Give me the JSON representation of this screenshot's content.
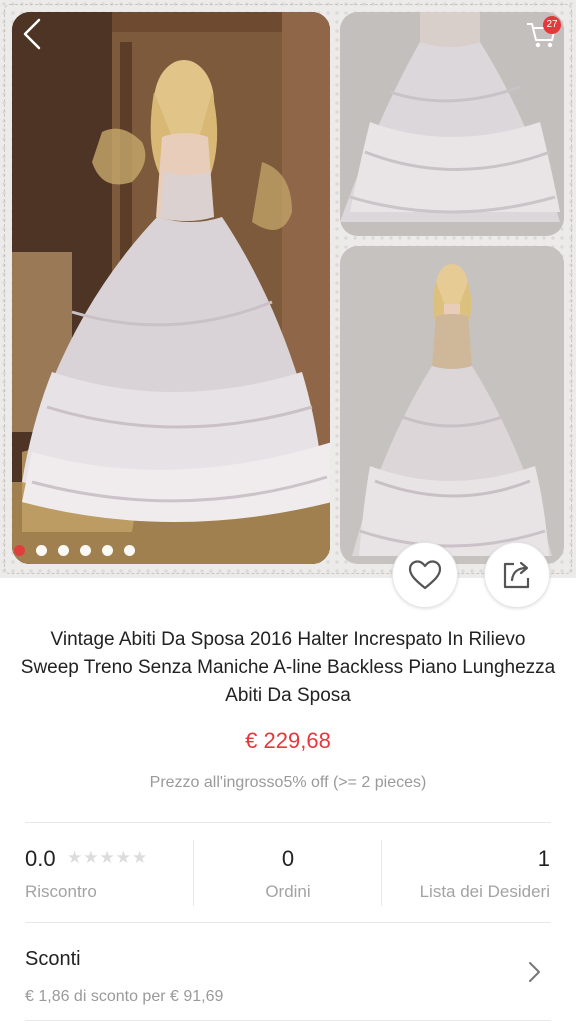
{
  "header": {
    "back_icon": "chevron-left-icon",
    "cart_icon": "shopping-cart-icon",
    "cart_count": "27"
  },
  "gallery": {
    "dots_total": 6,
    "active_dot": 0
  },
  "actions": {
    "favorite_icon": "heart-outline-icon",
    "share_icon": "share-icon"
  },
  "product": {
    "title": "Vintage Abiti Da Sposa 2016 Halter Increspato In Rilievo Sweep Treno Senza Maniche A-line Backless Piano Lunghezza Abiti Da Sposa",
    "price": "€ 229,68",
    "wholesale": "Prezzo all'ingrosso5% off (>= 2 pieces)",
    "price_color": "#e4393c"
  },
  "stats": {
    "rating": {
      "value": "0.0",
      "label": "Riscontro",
      "stars": "★★★★★"
    },
    "orders": {
      "value": "0",
      "label": "Ordini"
    },
    "wishlist": {
      "value": "1",
      "label": "Lista dei Desideri"
    }
  },
  "discount": {
    "heading": "Sconti",
    "detail": "€ 1,86 di sconto per € 91,69",
    "chevron_icon": "chevron-right-icon"
  }
}
